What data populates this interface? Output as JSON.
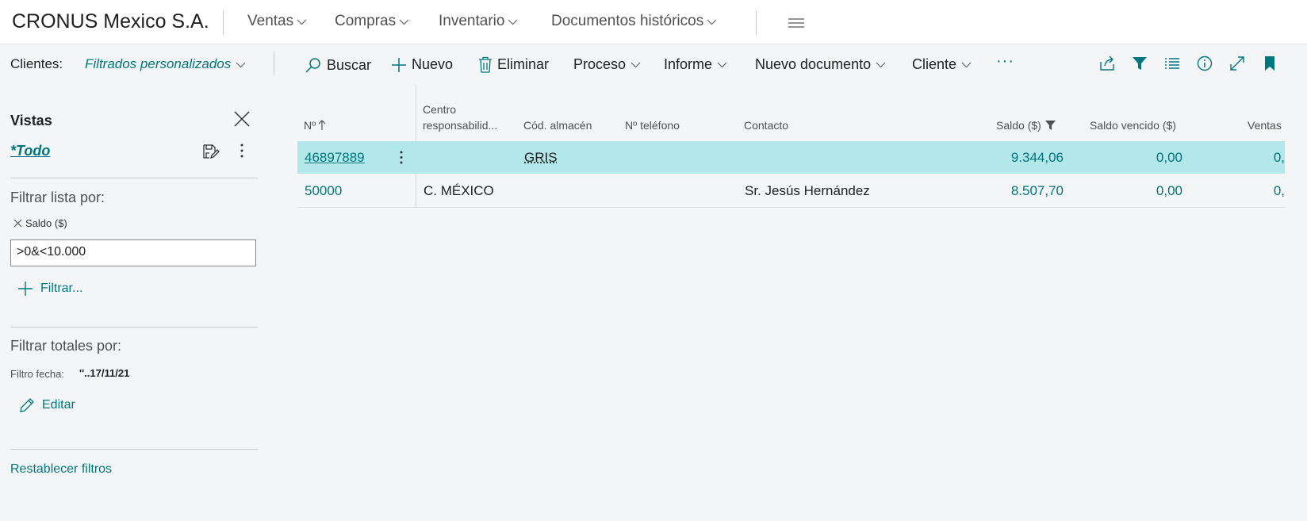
{
  "topbar": {
    "company": "CRONUS Mexico S.A.",
    "nav": [
      "Ventas",
      "Compras",
      "Inventario",
      "Documentos históricos"
    ]
  },
  "actionbar": {
    "list_label": "Clientes:",
    "view_name": "Filtrados personalizados",
    "search": "Buscar",
    "new": "Nuevo",
    "delete": "Eliminar",
    "process": "Proceso",
    "report": "Informe",
    "new_document": "Nuevo documento",
    "customer": "Cliente",
    "more": "···"
  },
  "sidebar": {
    "title": "Vistas",
    "view_all": "*Todo",
    "filter_list_label": "Filtrar lista por:",
    "filter_field": "Saldo ($)",
    "filter_value": ">0&<10.000",
    "add_filter": "Filtrar...",
    "filter_totals_label": "Filtrar totales por:",
    "date_filter_label": "Filtro fecha:",
    "date_filter_value": "''..17/11/21",
    "edit": "Editar",
    "reset": "Restablecer filtros"
  },
  "table": {
    "headers": {
      "no": "Nº",
      "center_line1": "Centro",
      "center_line2": "responsabilid...",
      "warehouse": "Cód. almacén",
      "phone": "Nº teléfono",
      "contact": "Contacto",
      "balance": "Saldo ($)",
      "balance_due": "Saldo vencido ($)",
      "sales": "Ventas"
    },
    "rows": [
      {
        "no": "46897889",
        "center": "",
        "warehouse": "GRIS",
        "phone": "",
        "contact": "",
        "balance": "9.344,06",
        "balance_due": "0,00",
        "sales": "0,"
      },
      {
        "no": "50000",
        "center": "C. MÉXICO",
        "warehouse": "",
        "phone": "",
        "contact": "Sr. Jesús Hernández",
        "balance": "8.507,70",
        "balance_due": "0,00",
        "sales": "0,"
      }
    ]
  },
  "colors": {
    "accent": "#00777f",
    "selected_row": "#b3e8ea",
    "background": "#f4f5f6"
  }
}
